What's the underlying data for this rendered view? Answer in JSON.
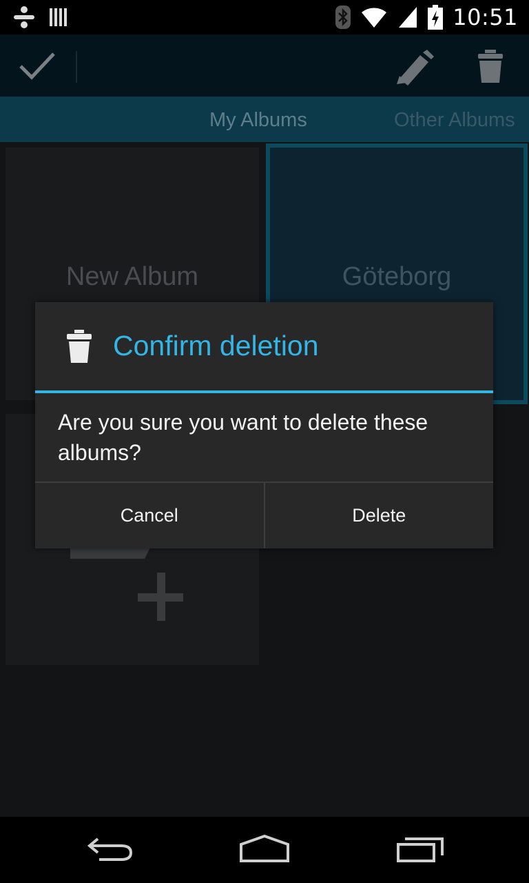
{
  "status_bar": {
    "time": "10:51",
    "icons": [
      "notification-icon",
      "barcode-icon",
      "bluetooth-icon",
      "wifi-icon",
      "signal-icon",
      "battery-charging-icon"
    ]
  },
  "action_bar": {
    "done_icon": "check-icon",
    "edit_icon": "pencil-icon",
    "delete_icon": "trash-icon"
  },
  "tabs": [
    {
      "label": "My Albums"
    },
    {
      "label": "Other Albums"
    }
  ],
  "albums": [
    {
      "label": "New Album"
    },
    {
      "label": "Göteborg"
    }
  ],
  "dialog": {
    "icon": "trash-icon",
    "title": "Confirm deletion",
    "message": "Are you sure you want to delete these albums?",
    "cancel_label": "Cancel",
    "delete_label": "Delete",
    "accent": "#33b5e5"
  },
  "nav_bar": {
    "icons": [
      "back-icon",
      "home-icon",
      "recent-apps-icon"
    ]
  }
}
